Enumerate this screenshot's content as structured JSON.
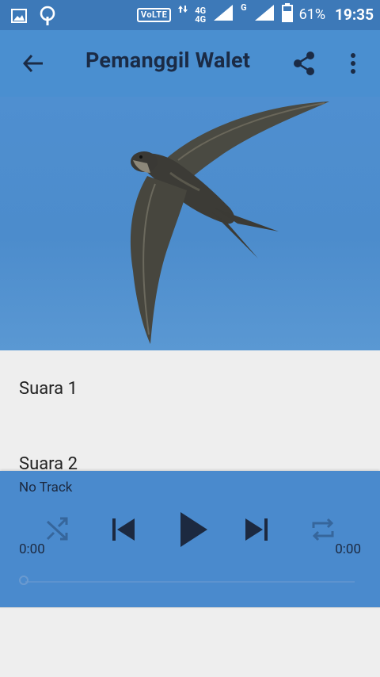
{
  "statusbar": {
    "volte": "VoLTE",
    "net_4g": "4G",
    "net_4g_small": "4G",
    "net_g": "G",
    "battery": "61%",
    "time": "19:35"
  },
  "toolbar": {
    "title": "Pemanggil Walet"
  },
  "tracks": [
    {
      "label": "Suara 1"
    },
    {
      "label": "Suara 2"
    }
  ],
  "player": {
    "now_playing": "No Track",
    "elapsed": "0:00",
    "duration": "0:00",
    "progress": 0
  },
  "colors": {
    "status_bar": "#3d79b8",
    "toolbar": "#4a8fd0",
    "player": "#4a8acd",
    "background": "#eeeeee"
  }
}
